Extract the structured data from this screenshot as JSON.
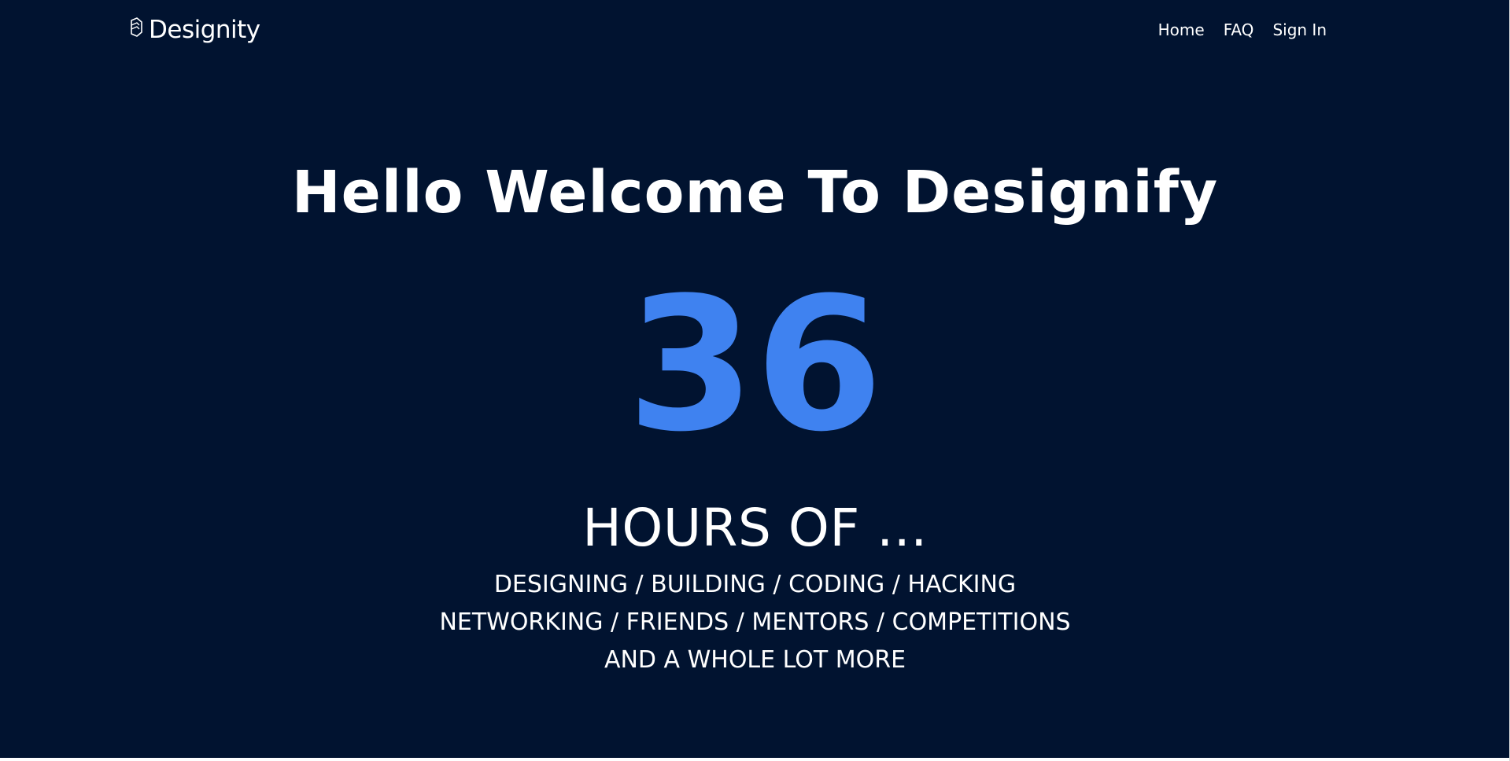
{
  "header": {
    "logo_text": "Designity",
    "logo_icon": "designity-logo-icon",
    "nav": [
      {
        "label": "Home"
      },
      {
        "label": "FAQ"
      },
      {
        "label": "Sign In"
      }
    ]
  },
  "hero": {
    "title": "Hello Welcome To Designify",
    "count": "36",
    "subtitle": "HOURS OF ...",
    "lines": [
      "DESIGNING / BUILDING / CODING / HACKING",
      "NETWORKING / FRIENDS / MENTORS / COMPETITIONS",
      "AND A WHOLE LOT MORE"
    ]
  },
  "colors": {
    "background": "#011330",
    "accent": "#3f82f0",
    "text": "#ffffff"
  }
}
